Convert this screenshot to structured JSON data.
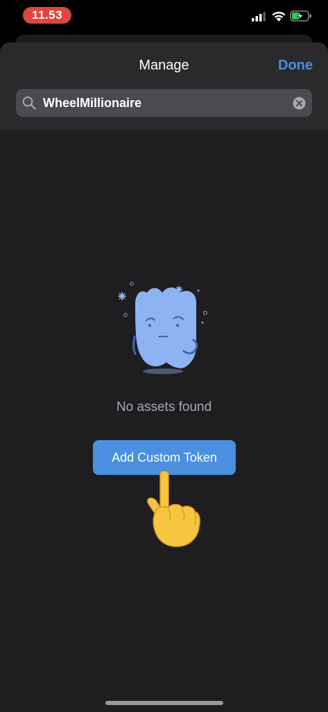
{
  "status_bar": {
    "time": "11.53",
    "time_pill_color": "#E0463D",
    "signal_icon": "cellular-signal-icon",
    "wifi_icon": "wifi-icon",
    "battery_icon": "battery-charging-icon"
  },
  "header": {
    "title": "Manage",
    "done_label": "Done",
    "accent_color": "#4A8FE0"
  },
  "search": {
    "value": "WheelMillionaire",
    "search_icon": "search-icon",
    "clear_icon": "clear-icon"
  },
  "empty_state": {
    "illustration": "confused-ghost-illustration",
    "message": "No assets found",
    "button_label": "Add Custom Token"
  },
  "overlay": {
    "pointing_icon": "pointing-hand-icon"
  }
}
